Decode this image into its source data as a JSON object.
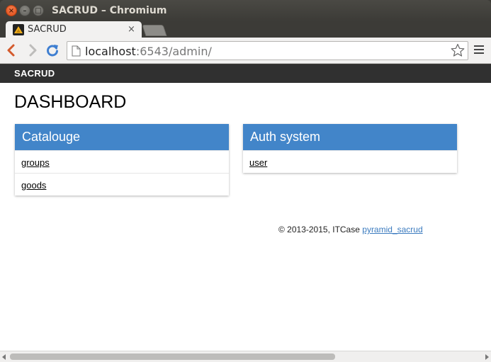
{
  "window": {
    "title": "SACRUD – Chromium",
    "close_glyph": "×",
    "min_glyph": "–",
    "max_glyph": "□"
  },
  "tab": {
    "title": "SACRUD",
    "close_glyph": "×"
  },
  "toolbar": {
    "url_host": "localhost",
    "url_rest": ":6543/admin/"
  },
  "appbar": {
    "brand": "SACRUD"
  },
  "main": {
    "title": "DASHBOARD",
    "panels": [
      {
        "title": "Catalouge",
        "links": [
          "groups",
          "goods"
        ]
      },
      {
        "title": "Auth system",
        "links": [
          "user"
        ]
      }
    ]
  },
  "footer": {
    "copyright": "© 2013-2015, ITCase",
    "link": "pyramid_sacrud"
  },
  "scrollbar": {
    "horizontal_position": 0.0,
    "visible_fraction": 0.69
  },
  "colors": {
    "panel_header": "#4285c9",
    "appbar": "#303030",
    "link": "#3b7bbf"
  },
  "icons": {
    "back": "arrow-left-icon",
    "forward": "arrow-right-icon",
    "reload": "reload-icon",
    "page": "page-icon",
    "star": "star-icon",
    "menu": "hamburger-menu-icon"
  }
}
